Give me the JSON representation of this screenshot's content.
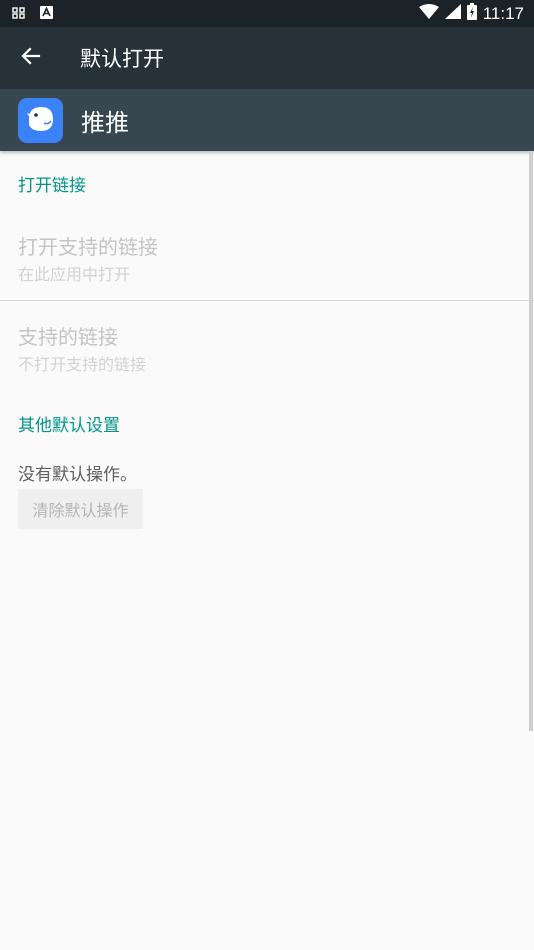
{
  "status_bar": {
    "time": "11:17",
    "left_icons": [
      "screenshot-icon",
      "android-icon"
    ],
    "right_icons": [
      "wifi-icon",
      "cell-signal-icon",
      "battery-charging-icon"
    ]
  },
  "toolbar": {
    "title": "默认打开",
    "back_icon": "arrow-back-icon"
  },
  "app": {
    "name": "推推",
    "icon": "bird-icon",
    "icon_color": "#3b82f6"
  },
  "sections": {
    "open_links": {
      "header": "打开链接",
      "open_supported": {
        "title": "打开支持的链接",
        "summary": "在此应用中打开"
      },
      "supported_links": {
        "title": "支持的链接",
        "summary": "不打开支持的链接"
      }
    },
    "other_defaults": {
      "header": "其他默认设置",
      "status_text": "没有默认操作。",
      "clear_button": "清除默认操作"
    }
  },
  "colors": {
    "accent": "#009688",
    "toolbar": "#263238",
    "app_header": "#37474f"
  }
}
